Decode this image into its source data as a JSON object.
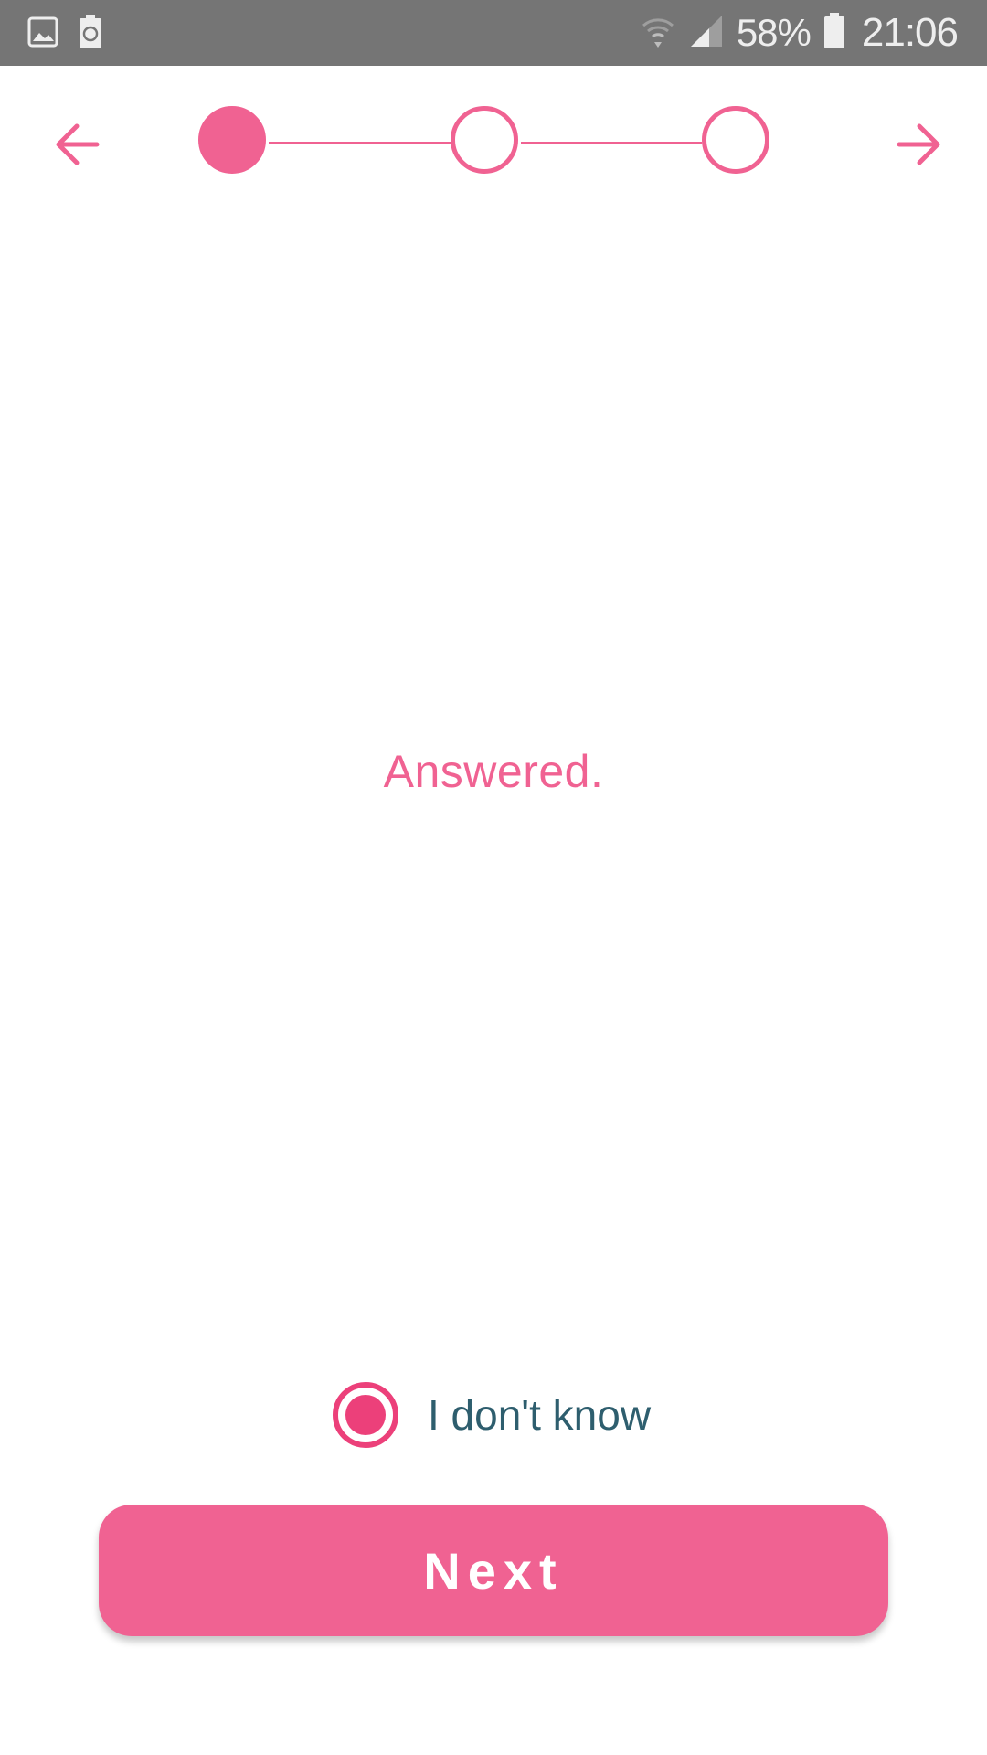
{
  "status_bar": {
    "left_icons": [
      "gallery-icon",
      "battery-saver-icon"
    ],
    "right_icons": [
      "wifi-icon",
      "signal-icon",
      "battery-icon"
    ],
    "battery_percent": "58%",
    "time": "21:06"
  },
  "stepper": {
    "steps": [
      {
        "state": "active"
      },
      {
        "state": "inactive"
      },
      {
        "state": "inactive"
      }
    ],
    "prev_icon": "arrow-left-icon",
    "next_icon": "arrow-right-icon"
  },
  "main": {
    "message": "Answered."
  },
  "option": {
    "label": "I don't know",
    "selected": true
  },
  "actions": {
    "next_label": "Next"
  },
  "colors": {
    "accent": "#f06292",
    "radio": "#ec407a",
    "label_text": "#2e5e6e",
    "status_bar": "#757575"
  }
}
